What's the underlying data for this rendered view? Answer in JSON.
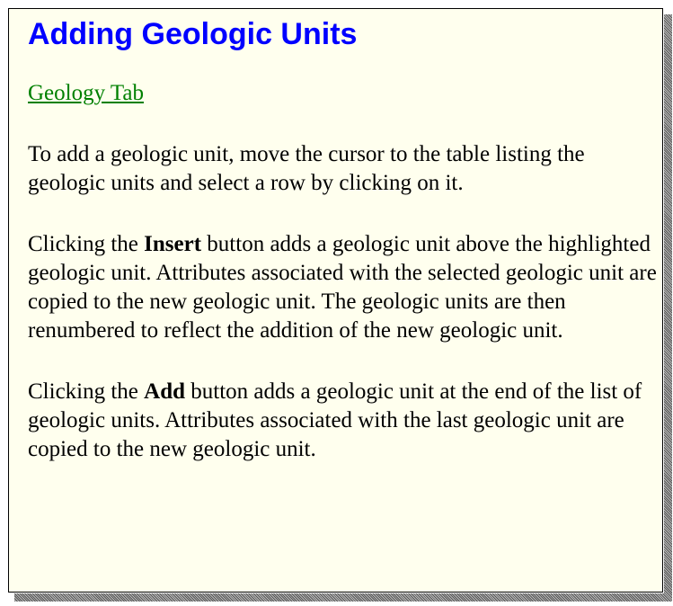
{
  "topic": {
    "title": "Adding Geologic Units",
    "link_label": "Geology Tab",
    "para1": "To add a geologic unit, move the cursor to the table listing the geologic units and select a row by clicking on it.",
    "para2": {
      "before": "Clicking the ",
      "bold": "Insert",
      "after": " button adds a geologic unit above the highlighted geologic unit.  Attributes associated with the selected geologic unit are copied to the new geologic unit. The geologic units are then renumbered to reflect the addition of the new geologic unit."
    },
    "para3": {
      "before": "Clicking the ",
      "bold": "Add",
      "after": " button adds a geologic unit at the end of the list of geologic units.  Attributes associated with the last geologic unit are copied to the new geologic unit."
    }
  },
  "colors": {
    "background": "#ffffee",
    "title": "#0000ff",
    "link": "#008000",
    "text": "#000000"
  }
}
